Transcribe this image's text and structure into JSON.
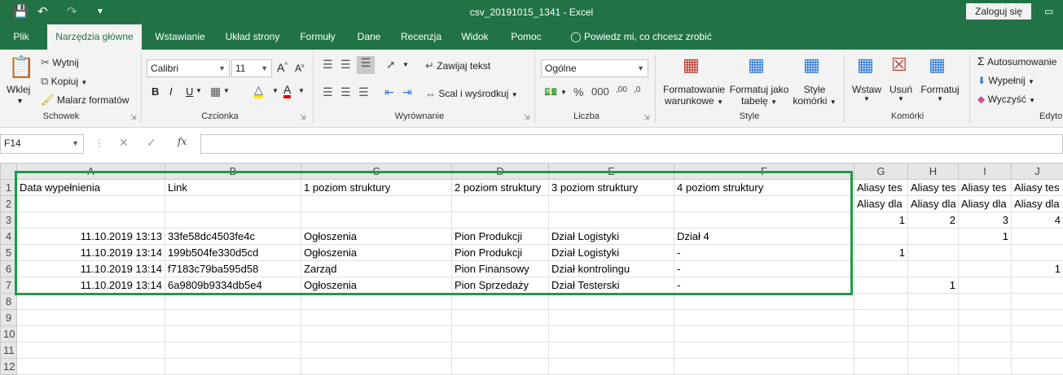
{
  "window": {
    "title": "csv_20191015_1341  -  Excel",
    "login": "Zaloguj się"
  },
  "tabs": [
    {
      "label": "Plik"
    },
    {
      "label": "Narzędzia główne"
    },
    {
      "label": "Wstawianie"
    },
    {
      "label": "Układ strony"
    },
    {
      "label": "Formuły"
    },
    {
      "label": "Dane"
    },
    {
      "label": "Recenzja"
    },
    {
      "label": "Widok"
    },
    {
      "label": "Pomoc"
    },
    {
      "label": "Powiedz mi, co chcesz zrobić"
    }
  ],
  "ribbon": {
    "clipboard": {
      "paste": "Wklej",
      "cut": "Wytnij",
      "copy": "Kopiuj",
      "painter": "Malarz formatów",
      "group": "Schowek"
    },
    "font": {
      "name": "Calibri",
      "size": "11",
      "group": "Czcionka"
    },
    "alignment": {
      "wrap": "Zawijaj tekst",
      "merge": "Scal i wyśrodkuj",
      "group": "Wyrównanie"
    },
    "number": {
      "format": "Ogólne",
      "group": "Liczba"
    },
    "styles": {
      "cond1": "Formatowanie",
      "cond2": "warunkowe",
      "table1": "Formatuj jako",
      "table2": "tabelę",
      "cell1": "Style",
      "cell2": "komórki",
      "group": "Style"
    },
    "cells": {
      "insert": "Wstaw",
      "delete": "Usuń",
      "format": "Formatuj",
      "group": "Komórki"
    },
    "editing": {
      "autosum": "Autosumowanie",
      "fill": "Wypełnij",
      "clear": "Wyczyść",
      "group": "Edyto"
    }
  },
  "formula_bar": {
    "name_box": "F14",
    "fx": "fx"
  },
  "columns": [
    "A",
    "B",
    "C",
    "D",
    "E",
    "F",
    "G",
    "H",
    "I",
    "J"
  ],
  "rows": [
    {
      "n": "1",
      "cells": [
        "Data wypełnienia",
        "Link",
        "1 poziom struktury",
        "2 poziom struktury",
        "3 poziom struktury",
        "4 poziom struktury",
        "Aliasy tes",
        "Aliasy tes",
        "Aliasy tes",
        "Aliasy tes"
      ]
    },
    {
      "n": "2",
      "cells": [
        "",
        "",
        "",
        "",
        "",
        "",
        "Aliasy dla",
        "Aliasy dla",
        "Aliasy dla",
        "Aliasy dla"
      ]
    },
    {
      "n": "3",
      "cells": [
        "",
        "",
        "",
        "",
        "",
        "",
        "1",
        "2",
        "3",
        "4"
      ]
    },
    {
      "n": "4",
      "cells": [
        "11.10.2019 13:13",
        "33fe58dc4503fe4c",
        "Ogłoszenia",
        "Pion Produkcji",
        "Dział Logistyki",
        "Dział 4",
        "",
        "",
        "1",
        ""
      ]
    },
    {
      "n": "5",
      "cells": [
        "11.10.2019 13:14",
        "199b504fe330d5cd",
        "Ogłoszenia",
        "Pion Produkcji",
        "Dział Logistyki",
        "-",
        "1",
        "",
        "",
        ""
      ]
    },
    {
      "n": "6",
      "cells": [
        "11.10.2019 13:14",
        "f7183c79ba595d58",
        "Zarząd",
        "Pion Finansowy",
        "Dział kontrolingu",
        "-",
        "",
        "",
        "",
        "1"
      ]
    },
    {
      "n": "7",
      "cells": [
        "11.10.2019 13:14",
        "6a9809b9334db5e4",
        "Ogłoszenia",
        "Pion Sprzedaży",
        "Dział Testerski",
        "-",
        "",
        "1",
        "",
        ""
      ]
    },
    {
      "n": "8",
      "cells": [
        "",
        "",
        "",
        "",
        "",
        "",
        "",
        "",
        "",
        ""
      ]
    },
    {
      "n": "9",
      "cells": [
        "",
        "",
        "",
        "",
        "",
        "",
        "",
        "",
        "",
        ""
      ]
    },
    {
      "n": "10",
      "cells": [
        "",
        "",
        "",
        "",
        "",
        "",
        "",
        "",
        "",
        ""
      ]
    },
    {
      "n": "11",
      "cells": [
        "",
        "",
        "",
        "",
        "",
        "",
        "",
        "",
        "",
        ""
      ]
    },
    {
      "n": "12",
      "cells": [
        "",
        "",
        "",
        "",
        "",
        "",
        "",
        "",
        "",
        ""
      ]
    }
  ]
}
